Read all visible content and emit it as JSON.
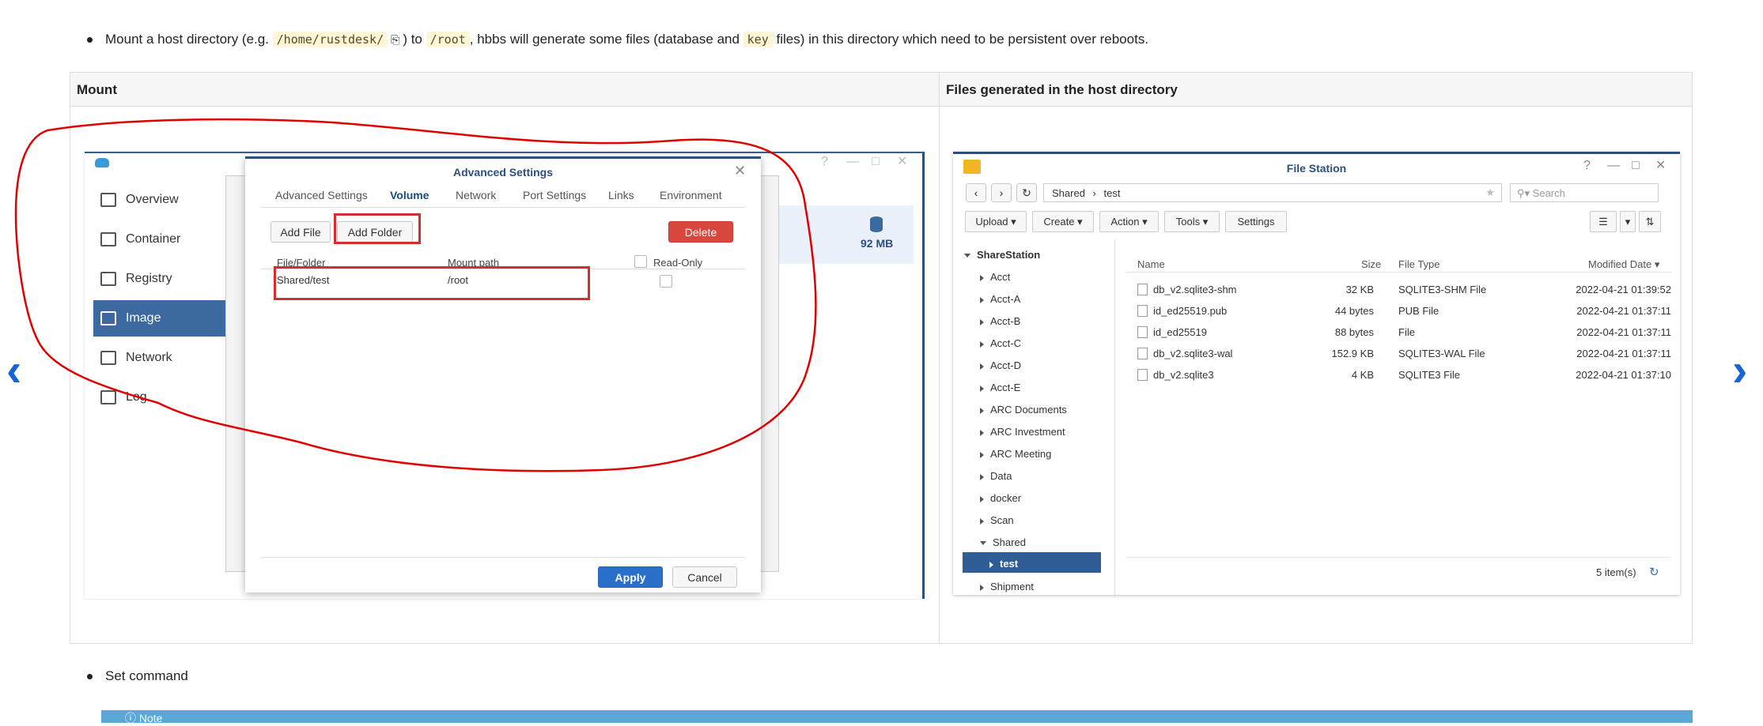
{
  "bullets": {
    "mount": {
      "prefix": "Mount a host directory (e.g. ",
      "code1": "/home/rustdesk/",
      "mid": ") to ",
      "code2": "/root",
      "mid2": ", hbbs will generate some files (database and ",
      "code3": "key",
      "suffix": " files) in this directory which need to be persistent over reboots."
    },
    "set_command": "Set command"
  },
  "table": {
    "col1_header": "Mount",
    "col2_header": "Files generated in the host directory"
  },
  "docker": {
    "nav": [
      "Overview",
      "Container",
      "Registry",
      "Image",
      "Network",
      "Log"
    ],
    "size_label": "92 MB"
  },
  "dialog": {
    "title": "Advanced Settings",
    "tabs": [
      "Advanced Settings",
      "Volume",
      "Network",
      "Port Settings",
      "Links",
      "Environment"
    ],
    "selected_tab": "Volume",
    "buttons": {
      "add_file": "Add File",
      "add_folder": "Add Folder",
      "delete": "Delete",
      "apply": "Apply",
      "cancel": "Cancel"
    },
    "columns": {
      "file_folder": "File/Folder",
      "mount_path": "Mount path",
      "read_only": "Read-Only"
    },
    "row": {
      "file_folder": "Shared/test",
      "mount_path": "/root"
    }
  },
  "file_station": {
    "title": "File Station",
    "path": [
      "Shared",
      "test"
    ],
    "search_placeholder": "Search",
    "toolbar": [
      "Upload",
      "Create",
      "Action",
      "Tools",
      "Settings"
    ],
    "tree_root": "ShareStation",
    "tree": [
      "Acct",
      "Acct-A",
      "Acct-B",
      "Acct-C",
      "Acct-D",
      "Acct-E",
      "ARC Documents",
      "ARC Investment",
      "ARC Meeting",
      "Data",
      "docker",
      "Scan",
      "Shared",
      "test",
      "Shipment"
    ],
    "columns": {
      "name": "Name",
      "size": "Size",
      "type": "File Type",
      "modified": "Modified Date"
    },
    "files": [
      {
        "name": "db_v2.sqlite3-shm",
        "size": "32 KB",
        "type": "SQLITE3-SHM File",
        "modified": "2022-04-21 01:39:52"
      },
      {
        "name": "id_ed25519.pub",
        "size": "44 bytes",
        "type": "PUB File",
        "modified": "2022-04-21 01:37:11"
      },
      {
        "name": "id_ed25519",
        "size": "88 bytes",
        "type": "File",
        "modified": "2022-04-21 01:37:11"
      },
      {
        "name": "db_v2.sqlite3-wal",
        "size": "152.9 KB",
        "type": "SQLITE3-WAL File",
        "modified": "2022-04-21 01:37:11"
      },
      {
        "name": "db_v2.sqlite3",
        "size": "4 KB",
        "type": "SQLITE3 File",
        "modified": "2022-04-21 01:37:10"
      }
    ],
    "status": "5 item(s)"
  },
  "note_label": "Note",
  "colors": {
    "annotation_red": "#e00000",
    "nav_blue": "#1565d8",
    "dsm_blue": "#3c6aa0"
  }
}
